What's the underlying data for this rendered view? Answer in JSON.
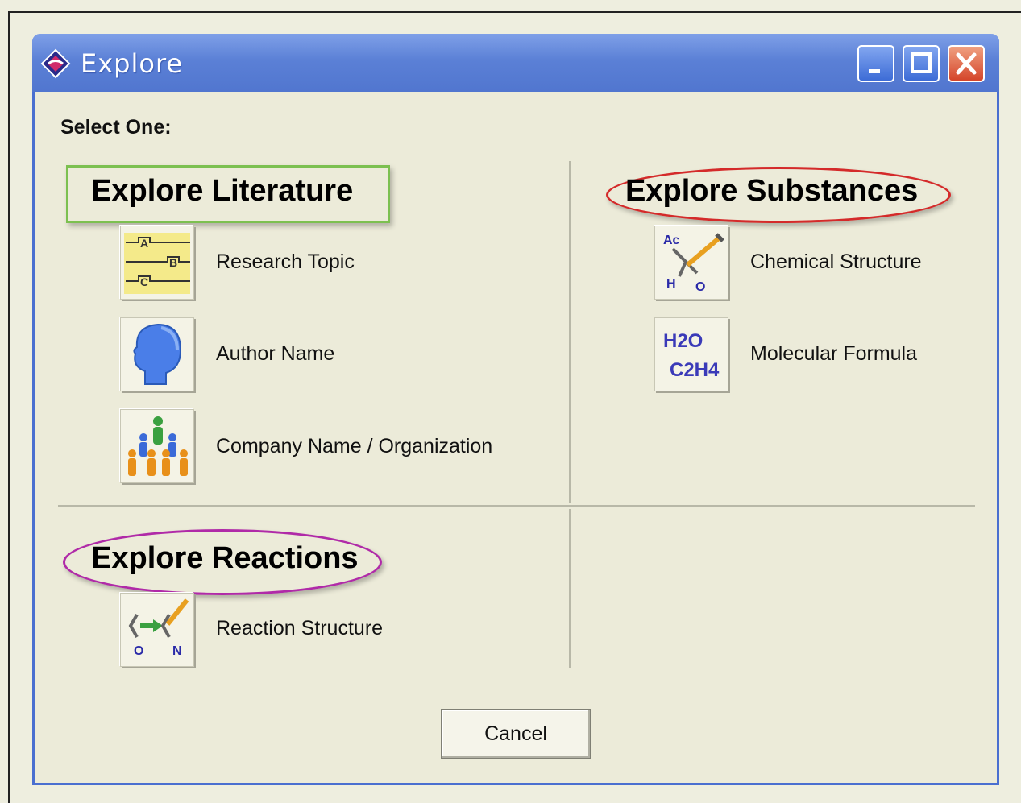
{
  "window": {
    "title": "Explore"
  },
  "prompt": "Select One:",
  "sections": {
    "literature": {
      "heading": "Explore Literature",
      "highlight_color": "#7cc050",
      "options": [
        {
          "label": "Research Topic",
          "icon": "research-topic-icon"
        },
        {
          "label": "Author Name",
          "icon": "author-head-icon"
        },
        {
          "label": "Company Name / Organization",
          "icon": "organization-people-icon"
        }
      ]
    },
    "substances": {
      "heading": "Explore Substances",
      "highlight_color": "#d42a2a",
      "options": [
        {
          "label": "Chemical Structure",
          "icon": "chemical-structure-icon"
        },
        {
          "label": "Molecular Formula",
          "icon": "molecular-formula-icon"
        }
      ]
    },
    "reactions": {
      "heading": "Explore Reactions",
      "highlight_color": "#b02aa8",
      "options": [
        {
          "label": "Reaction Structure",
          "icon": "reaction-structure-icon"
        }
      ]
    }
  },
  "formula_icon_text": {
    "line1": "H2O",
    "line2": "C2H4"
  },
  "structure_icon_text": {
    "ac": "Ac",
    "h": "H",
    "o": "O",
    "n": "N"
  },
  "buttons": {
    "cancel": "Cancel"
  }
}
